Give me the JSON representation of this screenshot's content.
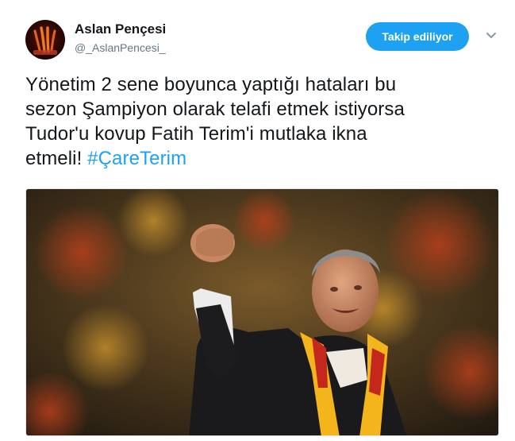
{
  "tweet": {
    "author": {
      "display_name": "Aslan Pençesi",
      "handle": "@_AslanPencesi_",
      "avatar_icon": "lion-claw-avatar-icon"
    },
    "follow_button": {
      "label": "Takip ediliyor"
    },
    "menu_icon": "chevron-down-icon",
    "text_lines": [
      "Yönetim 2 sene boyunca yaptığı hataları bu",
      "sezon Şampiyon olarak telafi etmek istiyorsa",
      "Tudor'u kovup Fatih Terim'i mutlaka ikna",
      "etmeli!"
    ],
    "hashtag": "#ÇareTerim",
    "media": {
      "type": "photo"
    }
  },
  "colors": {
    "accent": "#1da1f2",
    "text": "#14171a",
    "secondary": "#657786"
  }
}
